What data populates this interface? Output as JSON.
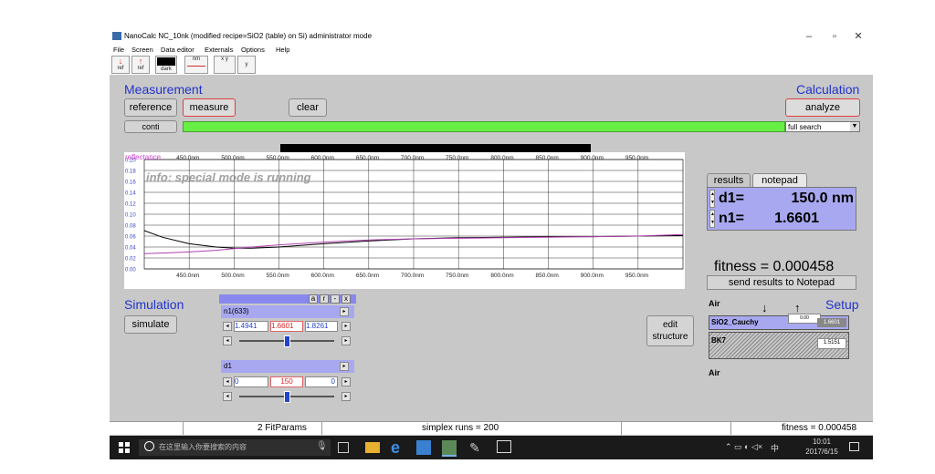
{
  "window": {
    "title": "NanoCalc NC_10nk   (modified recipe=SiO2 (table) on Si)   administrator mode",
    "controls": {
      "minimize": "–",
      "maximize": "▫",
      "close": "✕"
    }
  },
  "menu": [
    "File",
    "Screen",
    "Data editor",
    "Externals",
    "Options",
    "Help"
  ],
  "toolbar": {
    "ref1": "ref",
    "ref2": "ref",
    "dark": "dark",
    "nm": "nm",
    "xy": "x y",
    "y": "y"
  },
  "measurement": {
    "heading": "Measurement",
    "reference": "reference",
    "measure": "measure",
    "clear": "clear",
    "conti": "conti"
  },
  "calculation": {
    "heading": "Calculation",
    "analyze": "analyze",
    "search_mode": "full search"
  },
  "chart_data": {
    "type": "line",
    "ylabel": "reflectance",
    "annotation": "info: special mode is running",
    "x_ticks": [
      "450.0nm",
      "500.0nm",
      "550.0nm",
      "600.0nm",
      "650.0nm",
      "700.0nm",
      "750.0nm",
      "800.0nm",
      "850.0nm",
      "900.0nm",
      "950.0nm"
    ],
    "y_ticks": [
      "0.20",
      "0.18",
      "0.16",
      "0.14",
      "0.12",
      "0.10",
      "0.08",
      "0.06",
      "0.04",
      "0.02",
      "0.00"
    ],
    "xlim": [
      400,
      1000
    ],
    "ylim": [
      0,
      0.2
    ],
    "grid": true,
    "series": [
      {
        "color": "#000000",
        "x": [
          400,
          420,
          450,
          480,
          500,
          520,
          550,
          600,
          650,
          700,
          750,
          800,
          850,
          900,
          950,
          1000
        ],
        "y": [
          0.07,
          0.058,
          0.046,
          0.04,
          0.038,
          0.038,
          0.04,
          0.046,
          0.051,
          0.055,
          0.057,
          0.058,
          0.059,
          0.059,
          0.06,
          0.061
        ]
      },
      {
        "color": "#b040b0",
        "x": [
          400,
          420,
          450,
          480,
          500,
          520,
          550,
          600,
          650,
          700,
          750,
          800,
          850,
          900,
          950,
          1000
        ],
        "y": [
          0.028,
          0.029,
          0.031,
          0.034,
          0.037,
          0.04,
          0.044,
          0.049,
          0.053,
          0.055,
          0.056,
          0.057,
          0.058,
          0.059,
          0.06,
          0.063
        ]
      }
    ]
  },
  "results": {
    "tab_results": "results",
    "tab_notepad": "notepad",
    "d1_label": "d1=",
    "d1_value": "150.0  nm",
    "n1_label": "n1=",
    "n1_value": "1.6601",
    "fitness": "fitness = 0.000458",
    "send": "send results to Notepad"
  },
  "simulation": {
    "heading": "Simulation",
    "simulate": "simulate",
    "panel_buttons": [
      "a",
      "r",
      "-",
      "x"
    ],
    "n1_label": "n1(633)",
    "n1_min": "1.4941",
    "n1_cur": "1.6601",
    "n1_max": "1.8261",
    "n1_slider": 0.5,
    "d1_label": "d1",
    "d1_min": "0",
    "d1_cur": "150",
    "d1_max": "0",
    "d1_slider": 0.5
  },
  "edit_structure": "edit\nstructure",
  "setup": {
    "heading": "Setup",
    "air_top": "Air",
    "layer1": "SiO2_Cauchy",
    "layer1_n": "1.6601",
    "substrate": "BK7",
    "substrate_n": "1.5151",
    "air_bottom": "Air",
    "small_val": "0.00"
  },
  "status": {
    "fit_params": "2 FitParams",
    "simplex": "simplex runs = 200",
    "fitness": "fitness = 0.000458"
  },
  "taskbar": {
    "search_placeholder": "在这里输入你要搜索的内容",
    "time": "10:01",
    "date": "2017/6/15",
    "ime": "中"
  }
}
